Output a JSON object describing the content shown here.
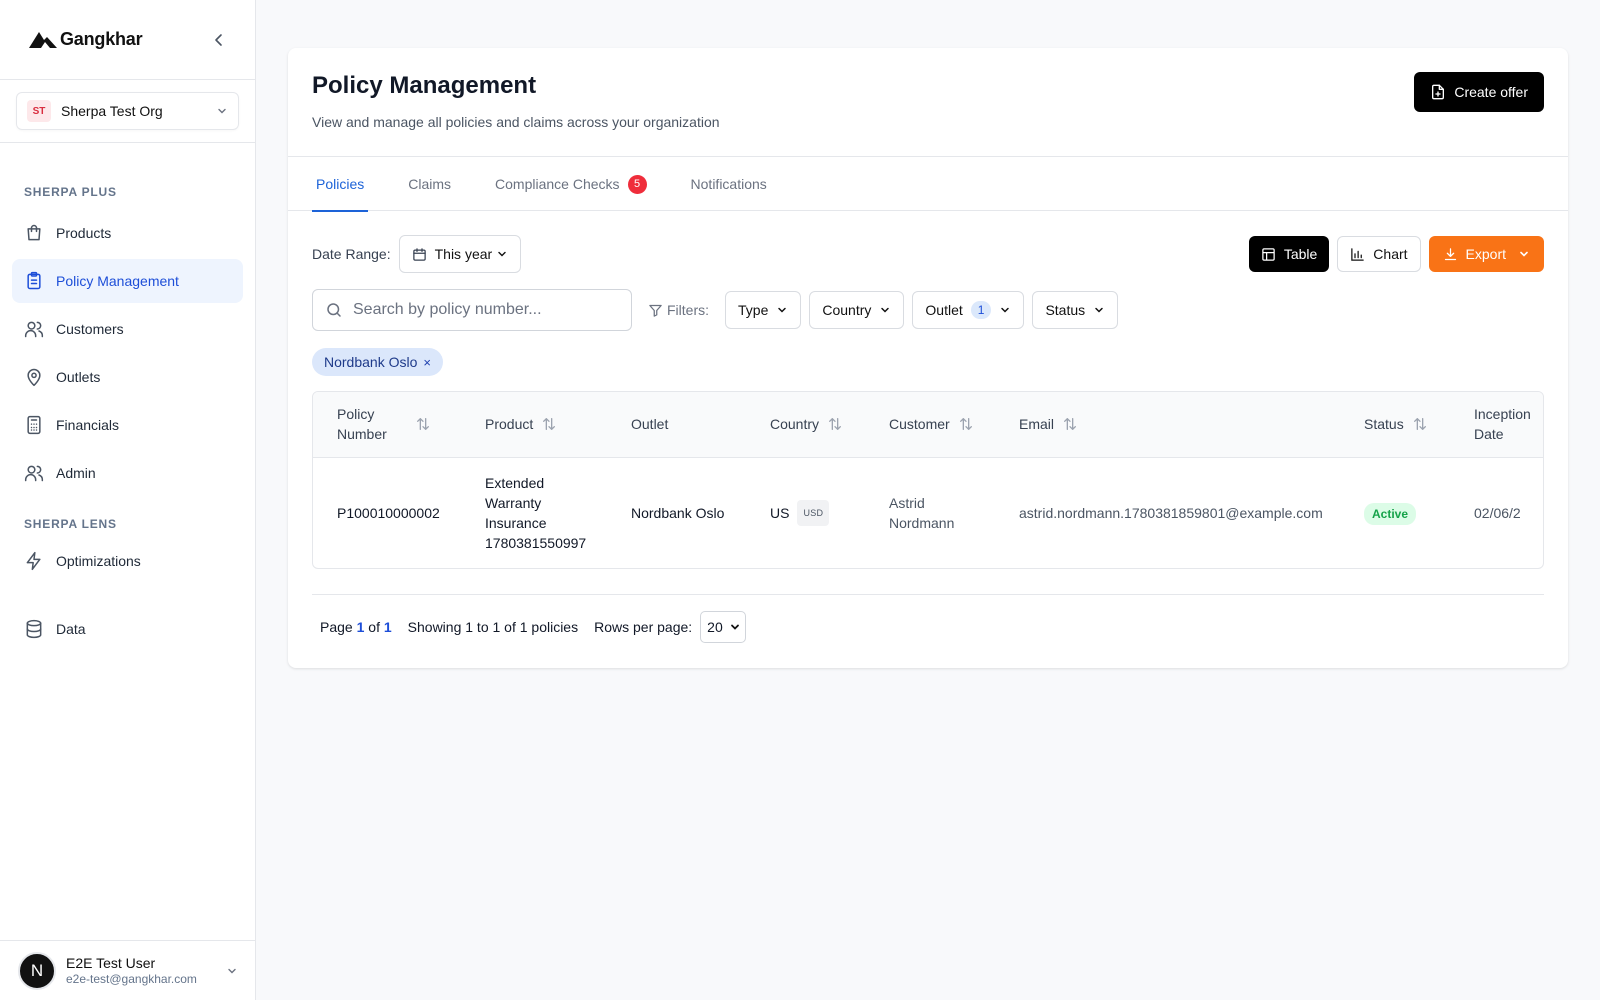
{
  "brand": {
    "name": "Gangkhar"
  },
  "org": {
    "initials": "ST",
    "name": "Sherpa Test Org"
  },
  "nav": {
    "section_plus": "SHERPA PLUS",
    "items_plus": [
      {
        "label": "Products",
        "icon": "shopping-bag-icon"
      },
      {
        "label": "Policy Management",
        "icon": "clipboard-list-icon"
      },
      {
        "label": "Customers",
        "icon": "users-icon"
      },
      {
        "label": "Outlets",
        "icon": "map-pin-icon"
      },
      {
        "label": "Financials",
        "icon": "calculator-icon"
      },
      {
        "label": "Admin",
        "icon": "users-icon"
      }
    ],
    "section_lens": "SHERPA LENS",
    "items_lens": [
      {
        "label": "Optimizations",
        "icon": "zap-icon"
      }
    ],
    "data_item": {
      "label": "Data",
      "icon": "database-icon"
    }
  },
  "user": {
    "initial": "N",
    "name": "E2E Test User",
    "email": "e2e-test@gangkhar.com"
  },
  "header": {
    "title": "Policy Management",
    "subtitle": "View and manage all policies and claims across your organization",
    "create_label": "Create offer"
  },
  "tabs": [
    {
      "label": "Policies"
    },
    {
      "label": "Claims"
    },
    {
      "label": "Compliance Checks",
      "badge": "5"
    },
    {
      "label": "Notifications"
    }
  ],
  "toolbar": {
    "date_range_label": "Date Range:",
    "date_range_value": "This year",
    "table_label": "Table",
    "chart_label": "Chart",
    "export_label": "Export"
  },
  "filters": {
    "search_placeholder": "Search by policy number...",
    "filters_label": "Filters:",
    "type_label": "Type",
    "country_label": "Country",
    "outlet_label": "Outlet",
    "outlet_count": "1",
    "status_label": "Status",
    "active_chip": "Nordbank Oslo",
    "chip_remove": "×"
  },
  "table": {
    "headers": {
      "policy_number": "Policy Number",
      "product": "Product",
      "outlet": "Outlet",
      "country": "Country",
      "customer": "Customer",
      "email": "Email",
      "status": "Status",
      "inception_date": "Inception Date"
    },
    "rows": [
      {
        "policy_number": "P100010000002",
        "product": "Extended Warranty Insurance 1780381550997",
        "outlet": "Nordbank Oslo",
        "country": "US",
        "currency": "USD",
        "customer": "Astrid Nordmann",
        "email": "astrid.nordmann.1780381859801@example.com",
        "status": "Active",
        "inception_date": "02/06/2"
      }
    ]
  },
  "pagination": {
    "page_word": "Page",
    "current": "1",
    "of_word": "of",
    "total": "1",
    "showing": "Showing 1 to 1 of 1 policies",
    "rows_label": "Rows per page:",
    "rows_value": "20"
  },
  "colors": {
    "accent": "#1d63d8",
    "export": "#f97316",
    "badge": "#ef2d3b",
    "status_active": "#16a34a"
  }
}
